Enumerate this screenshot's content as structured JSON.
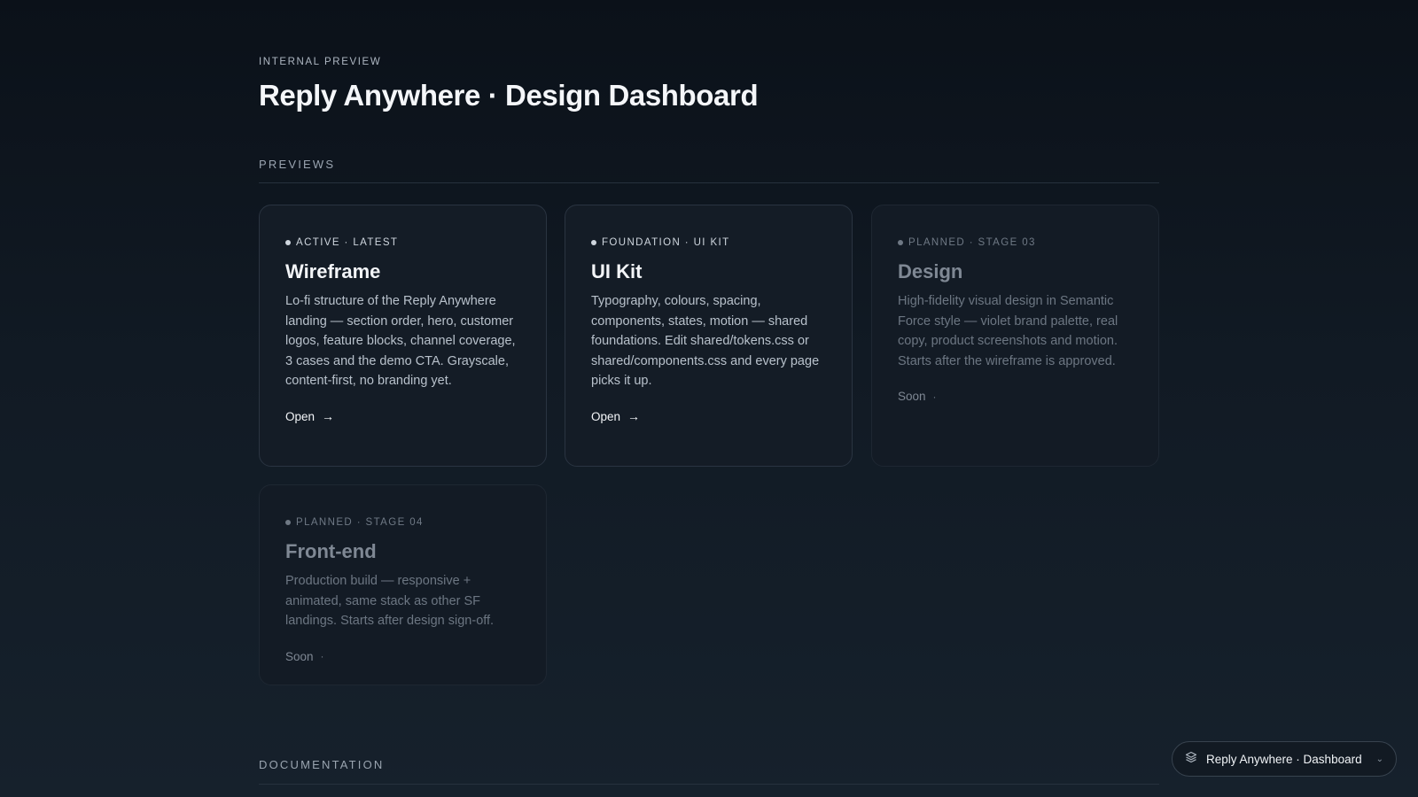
{
  "header": {
    "eyebrow": "INTERNAL PREVIEW",
    "title": "Reply Anywhere · Design Dashboard"
  },
  "sections": {
    "previews": "PREVIEWS",
    "documentation": "DOCUMENTATION"
  },
  "cards": [
    {
      "tag": "ACTIVE · LATEST",
      "name": "Wireframe",
      "description": "Lo-fi structure of the Reply Anywhere landing — section order, hero, customer logos, feature blocks, channel coverage, 3 cases and the demo CTA. Grayscale, content-first, no branding yet.",
      "action": "Open",
      "action_icon": "arrow-right-icon"
    },
    {
      "tag": "FOUNDATION · UI KIT",
      "name": "UI Kit",
      "description": "Typography, colours, spacing, components, states, motion — shared foundations. Edit shared/tokens.css or shared/components.css and every page picks it up.",
      "action": "Open",
      "action_icon": "arrow-right-icon"
    },
    {
      "tag": "PLANNED · STAGE 03",
      "name": "Design",
      "description": "High-fidelity visual design in Semantic Force style — violet brand palette, real copy, product screenshots and motion. Starts after the wireframe is approved.",
      "action": "Soon",
      "action_icon": "dot-icon"
    },
    {
      "tag": "PLANNED · STAGE 04",
      "name": "Front-end",
      "description": "Production build — responsive + animated, same stack as other SF landings. Starts after design sign-off.",
      "action": "Soon",
      "action_icon": "dot-icon"
    }
  ],
  "switcher": {
    "label": "Reply Anywhere · Dashboard",
    "icon": "layers-icon",
    "chevron": "chevron-down-icon"
  }
}
